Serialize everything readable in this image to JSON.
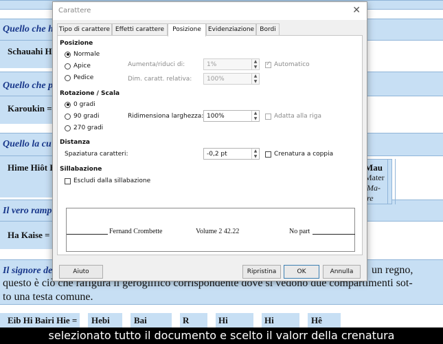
{
  "document": {
    "left_lines": [
      {
        "text": "Quello che h",
        "style": "blue"
      },
      {
        "text": "Schauahi H",
        "style": "bold"
      },
      {
        "text": "Quello che p",
        "style": "blue"
      },
      {
        "text": "Karoukin =",
        "style": "bold"
      },
      {
        "text": "Quello la cu",
        "style": "blue"
      },
      {
        "text": "Hime Hiôt H",
        "style": "bold"
      },
      {
        "text": "Il vero ramp",
        "style": "blue"
      },
      {
        "text": "Ha Kaise =",
        "style": "bold"
      },
      {
        "text": "Il signore de",
        "style": "blue"
      }
    ],
    "right_fragments": [
      {
        "text": "Mau",
        "style": "bold"
      },
      {
        "text": "Mater",
        "style": "plain"
      },
      {
        "text": "Ma-",
        "style": "ital"
      },
      {
        "text": "re",
        "style": "ital"
      },
      {
        "text": "un regno,",
        "style": "plain"
      }
    ],
    "body_lines": [
      "questo è ciò che rafigura il geroglifico corrispondente dove si vedono due compartimenti sot-",
      "to una testa comune."
    ],
    "bottom_row": [
      "Eib Hi Bairi Hie =",
      "Hebi",
      "Bai",
      "R",
      "Hi",
      "Hi",
      "Hê"
    ]
  },
  "dialog": {
    "title": "Carattere",
    "tabs": [
      {
        "label": "Tipo di carattere",
        "active": false
      },
      {
        "label": "Effetti carattere",
        "active": false
      },
      {
        "label": "Posizione",
        "active": true
      },
      {
        "label": "Evidenziazione",
        "active": false
      },
      {
        "label": "Bordi",
        "active": false
      }
    ],
    "posizione": {
      "title": "Posizione",
      "options": [
        {
          "label": "Normale",
          "selected": true
        },
        {
          "label": "Apice",
          "selected": false
        },
        {
          "label": "Pedice",
          "selected": false
        }
      ],
      "raise_label": "Aumenta/riduci di:",
      "raise_value": "1%",
      "auto_label": "Automatico",
      "auto_checked": true,
      "relsize_label": "Dim. caratt. relativa:",
      "relsize_value": "100%"
    },
    "rotazione": {
      "title": "Rotazione / Scala",
      "options": [
        {
          "label": "0 gradi",
          "selected": true
        },
        {
          "label": "90 gradi",
          "selected": false
        },
        {
          "label": "270 gradi",
          "selected": false
        }
      ],
      "scale_label": "Ridimensiona larghezza:",
      "scale_value": "100%",
      "fit_label": "Adatta alla riga",
      "fit_checked": false
    },
    "distanza": {
      "title": "Distanza",
      "spacing_label": "Spaziatura caratteri:",
      "spacing_value": "-0,2 pt",
      "kerning_label": "Crenatura a coppia",
      "kerning_checked": false
    },
    "sillabazione": {
      "title": "Sillabazione",
      "exclude_label": "Escludi dalla sillabazione",
      "exclude_checked": false
    },
    "preview": {
      "left": "Fernand Crombette",
      "center": "Volume 2  42.22",
      "right": "No part"
    },
    "buttons": {
      "help": "Aiuto",
      "reset": "Ripristina",
      "ok": "OK",
      "cancel": "Annulla"
    },
    "close_icon": "close-icon"
  },
  "caption": "selezionato tutto il documento e scelto il valorr della crenatura"
}
